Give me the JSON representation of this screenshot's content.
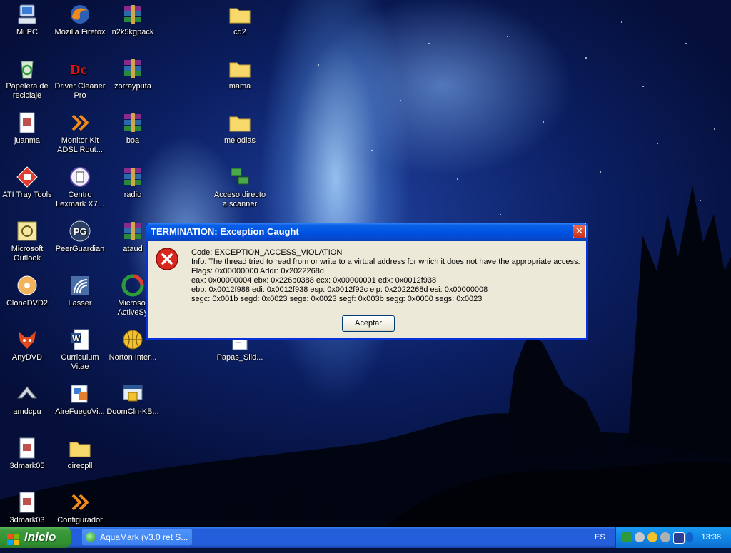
{
  "desktop": {
    "icons": [
      {
        "name": "mi-pc",
        "label": "Mi PC"
      },
      {
        "name": "mozilla-firefox",
        "label": "Mozilla Firefox"
      },
      {
        "name": "n2k5kgpack",
        "label": "n2k5kgpack"
      },
      {
        "name": "cd2",
        "label": "cd2"
      },
      {
        "name": "papelera-de-reciclaje",
        "label": "Papelera de reciclaje"
      },
      {
        "name": "driver-cleaner-pro",
        "label": "Driver Cleaner Pro"
      },
      {
        "name": "zorrayputa",
        "label": "zorrayputa"
      },
      {
        "name": "mama",
        "label": "mama"
      },
      {
        "name": "juanma",
        "label": "juanma"
      },
      {
        "name": "monitor-kit",
        "label": "Monitor Kit ADSL Rout..."
      },
      {
        "name": "boa",
        "label": "boa"
      },
      {
        "name": "melodias",
        "label": "melodias"
      },
      {
        "name": "ati-tray-tools",
        "label": "ATI Tray Tools"
      },
      {
        "name": "centro-lexmark",
        "label": "Centro Lexmark X7..."
      },
      {
        "name": "radio",
        "label": "radio"
      },
      {
        "name": "acceso-directo-scanner",
        "label": "Acceso directo a scanner"
      },
      {
        "name": "microsoft-outlook",
        "label": "Microsoft Outlook"
      },
      {
        "name": "peerguardian",
        "label": "PeerGuardian"
      },
      {
        "name": "ataud",
        "label": "ataud"
      },
      {
        "name": "clonedvd2",
        "label": "CloneDVD2"
      },
      {
        "name": "lasser",
        "label": "Lasser"
      },
      {
        "name": "microsoft-activesync",
        "label": "Microsof ActiveSy"
      },
      {
        "name": "anydvd",
        "label": "AnyDVD"
      },
      {
        "name": "curriculum-vitae",
        "label": "Curriculum Vitae"
      },
      {
        "name": "norton-internet",
        "label": "Norton Inter..."
      },
      {
        "name": "papas-slideshow",
        "label": "Papas_Slid..."
      },
      {
        "name": "amdcpu",
        "label": "amdcpu"
      },
      {
        "name": "airefuegovi",
        "label": "AireFuegoVi..."
      },
      {
        "name": "doomcln-kb",
        "label": "DoomCln-KB..."
      },
      {
        "name": "3dmark05",
        "label": "3dmark05"
      },
      {
        "name": "direcpll",
        "label": "direcpll"
      },
      {
        "name": "3dmark03",
        "label": "3dmark03"
      },
      {
        "name": "configurador",
        "label": "Configurador"
      }
    ]
  },
  "dialog": {
    "title": "TERMINATION: Exception Caught",
    "close_label": "✕",
    "lines": [
      "Code: EXCEPTION_ACCESS_VIOLATION",
      "Info: The thread tried to read from or write to a virtual address for which it does not have the appropriate access.",
      "Flags: 0x00000000 Addr: 0x2022268d",
      "eax: 0x00000004 ebx: 0x226b0388 ecx: 0x00000001 edx: 0x0012f938",
      "ebp: 0x0012f988 edi: 0x0012f938 esp: 0x0012f92c eip: 0x2022268d esi: 0x00000008",
      "segc: 0x001b segd: 0x0023 sege: 0x0023 segf: 0x003b segg: 0x0000 segs: 0x0023"
    ],
    "ok_label": "Aceptar",
    "icon": "error-icon"
  },
  "taskbar": {
    "start_label": "Inicio",
    "task_label": "AquaMark (v3.0 ret S...",
    "language": "ES",
    "clock": "13:38",
    "tray_icons": [
      "cpu-meter-icon",
      "speaker-icon",
      "network-globe-icon",
      "ati-icon",
      "power-icon",
      "bluetooth-icon"
    ]
  },
  "colors": {
    "titlebar": "#0054e3",
    "dialog_bg": "#ece9d8",
    "taskbar": "#245edb",
    "start": "#3c9a3c",
    "tray": "#0f87e5"
  }
}
